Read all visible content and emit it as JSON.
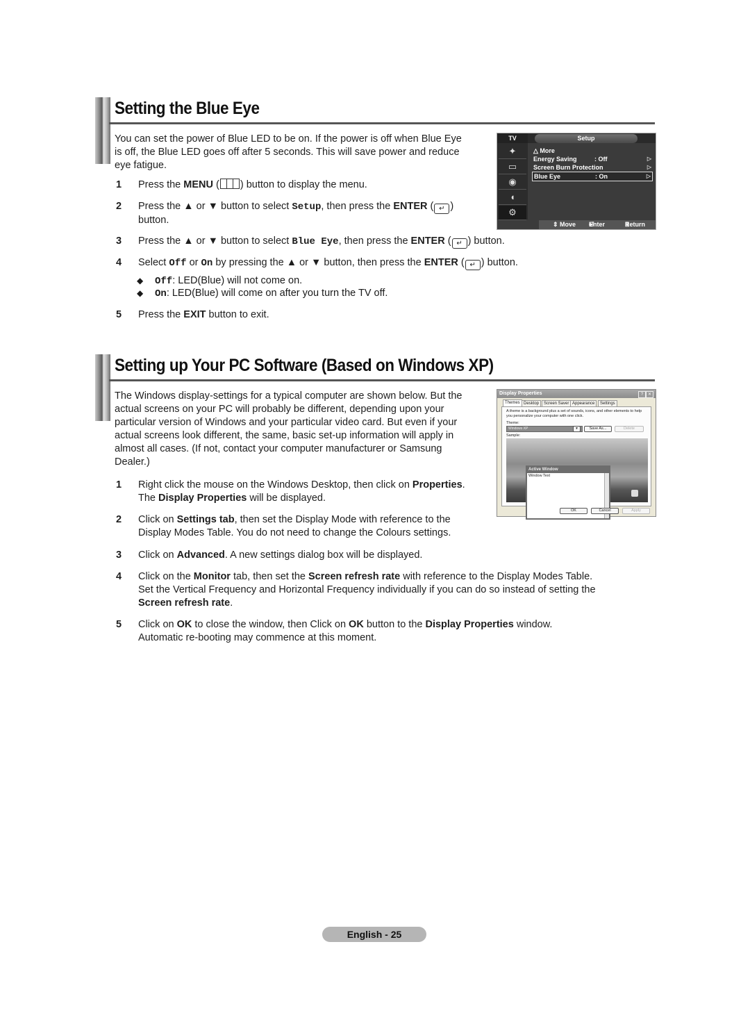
{
  "section1": {
    "heading": "Setting the Blue Eye",
    "intro": "You can set the power of Blue LED to be on. If the power is off when Blue Eye is off, the Blue LED goes off after 5 seconds. This will save power and reduce eye fatigue.",
    "intro_lines": [
      "You can set the power of Blue LED to be on. If the power is off when Blue Eye",
      "is off, the Blue LED goes off after 5 seconds. This will save power and reduce",
      "eye fatigue."
    ],
    "steps": [
      {
        "num": "1",
        "pre": "Press the ",
        "b1": "MENU",
        "mid": " (",
        "icon": "menu-icon",
        "post": ") button to display the menu."
      },
      {
        "num": "2",
        "pre": "Press the ▲ or ▼ button to select ",
        "code": "Setup",
        "mid": ", then press the ",
        "b1": "ENTER",
        "icon": "enter-icon",
        "post": ")",
        "line2": "button."
      },
      {
        "num": "3",
        "pre": "Press the ▲ or ▼ button to select ",
        "code": "Blue Eye",
        "mid": ", then press the ",
        "b1": "ENTER",
        "icon": "enter-icon",
        "post": ") button."
      },
      {
        "num": "4",
        "pre": "Select ",
        "code1": "Off",
        "or": " or ",
        "code2": "On",
        "mid": " by pressing the ▲ or ▼ button, then press the ",
        "b1": "ENTER",
        "icon": "enter-icon",
        "post": ") button."
      },
      {
        "num": "5",
        "pre": "Press the ",
        "b1": "EXIT",
        "post": " button to exit."
      }
    ],
    "bullets": [
      {
        "code": "Off",
        "text": ": LED(Blue) will not come on."
      },
      {
        "code": "On",
        "text": ": LED(Blue) will come on after you turn the TV off."
      }
    ],
    "bullet_glyph": "◆"
  },
  "tv_menu": {
    "source_label": "TV",
    "title": "Setup",
    "icons": [
      "picture-icon",
      "sound-icon",
      "channel-icon",
      "input-icon",
      "setup-icon"
    ],
    "items": [
      {
        "label": "△ More",
        "value": "",
        "arrow": ""
      },
      {
        "label": "Energy Saving",
        "value": ": Off",
        "arrow": "▷"
      },
      {
        "label": "Screen Burn Protection",
        "value": "",
        "arrow": "▷"
      },
      {
        "label": "Blue Eye",
        "value": ": On",
        "arrow": "▷",
        "selected": true
      }
    ],
    "footer": {
      "move": "⇕ Move",
      "enter": "Enter",
      "return": "Return"
    }
  },
  "section2": {
    "heading": "Setting up Your PC Software (Based on Windows XP)",
    "intro_lines": [
      "The Windows display-settings for a typical computer are shown below. But the",
      "actual screens on your PC will probably be different, depending upon your",
      "particular version of Windows and your particular video card. But even if your",
      "actual screens look different, the same, basic set-up information will apply in",
      "almost all cases. (If not, contact your computer manufacturer or Samsung",
      "Dealer.)"
    ],
    "steps": [
      {
        "num": "1",
        "l1a": "Right click the mouse on the Windows Desktop, then click on ",
        "l1b": "Properties",
        "l1c": ".",
        "l2a": "The ",
        "l2b": "Display Properties",
        "l2c": " will be displayed."
      },
      {
        "num": "2",
        "l1a": "Click on ",
        "l1b": "Settings tab",
        "l1c": ", then set the Display Mode with reference to the",
        "l2a": "Display Modes Table. You do not need to change the Colours settings."
      },
      {
        "num": "3",
        "l1a": "Click on ",
        "l1b": "Advanced",
        "l1c": ". A new settings dialog box will be displayed."
      },
      {
        "num": "4",
        "l1a": "Click on the ",
        "l1b": "Monitor",
        "l1c": " tab, then set the ",
        "l1d": "Screen refresh rate",
        "l1e": " with reference to the Display Modes Table.",
        "l2a": "Set the Vertical Frequency and Horizontal Frequency individually if you can do so instead of setting the",
        "l3b": "Screen refresh rate",
        "l3c": "."
      },
      {
        "num": "5",
        "l1a": "Click on ",
        "l1b": "OK",
        "l1c": " to close the window, then Click on ",
        "l1d": "OK",
        "l1e": " button to the ",
        "l1f": "Display Properties",
        "l1g": " window.",
        "l2a": "Automatic re-booting may commence at this moment."
      }
    ]
  },
  "display_properties": {
    "title": "Display Properties",
    "help_btn": "?",
    "close_btn": "✕",
    "tabs": [
      "Themes",
      "Desktop",
      "Screen Saver",
      "Appearance",
      "Settings"
    ],
    "selected_tab": "Themes",
    "description": "A theme is a background plus a set of sounds, icons, and other elements to help you personalize your computer with one click.",
    "theme_label": "Theme:",
    "theme_value": "Windows XP",
    "save_as": "Save As...",
    "delete": "Delete",
    "sample_label": "Sample:",
    "active_window_title": "Active Window",
    "window_text": "Window Text",
    "buttons": {
      "ok": "OK",
      "cancel": "Cancel",
      "apply": "Apply"
    }
  },
  "footer": {
    "page_label": "English - 25"
  }
}
